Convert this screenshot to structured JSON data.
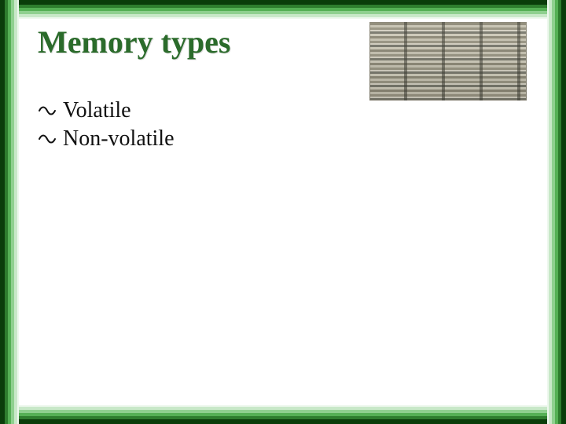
{
  "title": "Memory types",
  "bullets": [
    {
      "label": "Volatile"
    },
    {
      "label": "Non-volatile"
    }
  ],
  "image_alt": "Rack of memory modules"
}
